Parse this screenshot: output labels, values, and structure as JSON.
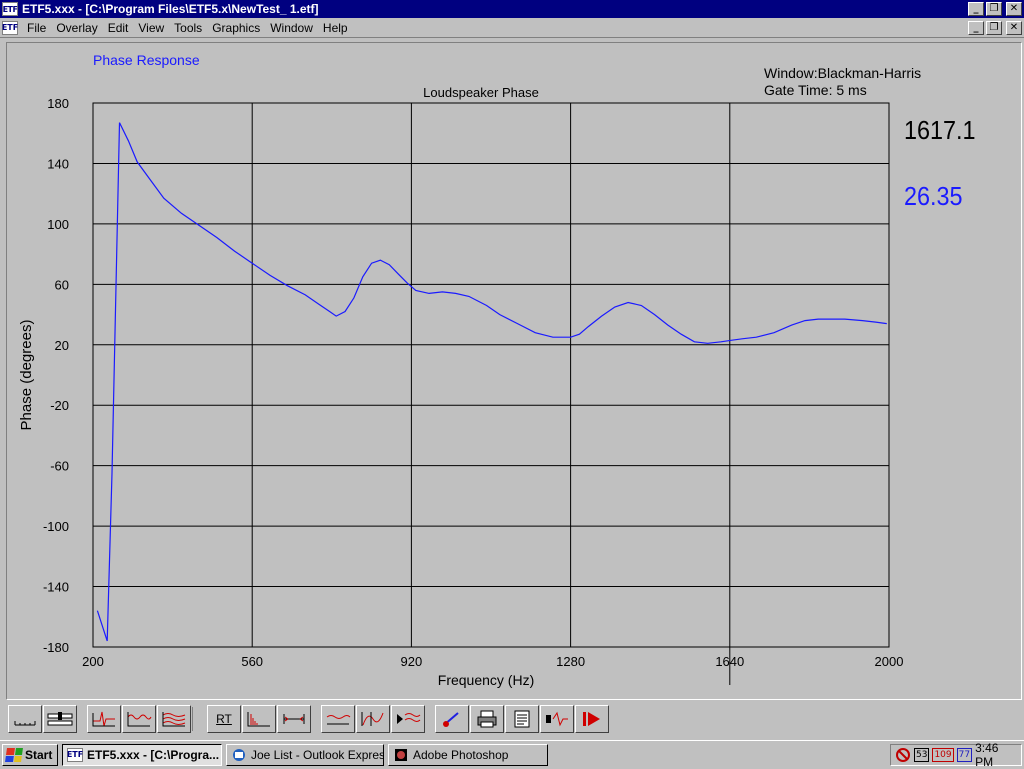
{
  "window": {
    "title": "ETF5.xxx - [C:\\Program Files\\ETF5.x\\NewTest_ 1.etf]",
    "app_icon_text": "ETF",
    "controls": [
      "_",
      "❐",
      "✕"
    ]
  },
  "menu": {
    "items": [
      "File",
      "Overlay",
      "Edit",
      "View",
      "Tools",
      "Graphics",
      "Window",
      "Help"
    ]
  },
  "panel": {
    "label": "Phase Response",
    "label_color": "#1a1aff",
    "window_info": "Window:Blackman-Harris",
    "gate_info": "Gate Time: 5 ms",
    "cursor_frequency": "1617.1",
    "cursor_phase": "26.35",
    "cursor_phase_color": "#1a1aff"
  },
  "chart_data": {
    "type": "line",
    "title": "Loudspeaker Phase",
    "xlabel": "Frequency (Hz)",
    "ylabel": "Phase (degrees)",
    "xlim": [
      200,
      2000
    ],
    "ylim": [
      -180,
      180
    ],
    "xticks": [
      200,
      560,
      920,
      1280,
      1640,
      2000
    ],
    "yticks": [
      180,
      140,
      100,
      60,
      20,
      -20,
      -60,
      -100,
      -140,
      -180
    ],
    "grid": true,
    "cursor_x": 1640,
    "series": [
      {
        "color": "#1a1aff",
        "x": [
          210,
          232,
          243,
          260,
          280,
          300,
          330,
          360,
          400,
          440,
          480,
          520,
          560,
          600,
          640,
          680,
          710,
          735,
          750,
          770,
          790,
          810,
          830,
          850,
          870,
          890,
          910,
          930,
          960,
          990,
          1020,
          1050,
          1090,
          1120,
          1160,
          1200,
          1240,
          1280,
          1300,
          1320,
          1350,
          1380,
          1410,
          1440,
          1470,
          1500,
          1530,
          1560,
          1590,
          1620,
          1645,
          1670,
          1700,
          1740,
          1780,
          1810,
          1840,
          1870,
          1900,
          1940,
          1970,
          1995
        ],
        "y": [
          -156,
          -176,
          -65,
          167,
          155,
          141,
          129,
          117,
          107,
          99,
          91,
          82,
          74,
          66,
          59,
          53,
          47,
          42,
          39,
          42,
          51,
          65,
          74,
          76,
          73,
          67,
          61,
          56,
          54,
          55,
          54,
          52,
          46,
          40,
          34,
          28,
          25,
          25,
          27,
          32,
          39,
          45,
          48,
          46,
          40,
          33,
          27,
          22,
          21,
          22,
          23,
          24,
          25,
          28,
          33,
          36,
          37,
          37,
          37,
          36,
          35,
          34
        ]
      }
    ]
  },
  "toolbar": {
    "rt_label": "RT"
  },
  "taskbar": {
    "start": "Start",
    "tasks": [
      "ETF5.xxx - [C:\\Progra...",
      "Joe List - Outlook Express",
      "Adobe Photoshop"
    ],
    "tray_icons": [
      "53",
      "109",
      "77"
    ],
    "clock": "3:46 PM"
  }
}
